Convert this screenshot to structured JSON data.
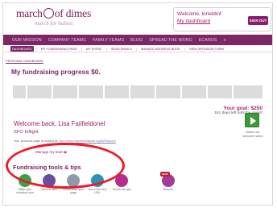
{
  "header": {
    "logo_main_left": "march",
    "logo_main_right": "of dimes",
    "logo_tagline": "march for babies",
    "welcome_text": "Welcome, lorieldinf",
    "dashboard_link": "My dashboard",
    "sign_out_label": "SIGN OUT"
  },
  "nav": {
    "items": [
      {
        "label": "OUR MISSION"
      },
      {
        "label": "COMPANY TEAMS"
      },
      {
        "label": "FAMILY TEAMS"
      },
      {
        "label": "BLOG"
      },
      {
        "label": "SPREAD THE WORD"
      },
      {
        "label": "ECARDS"
      }
    ],
    "more": "≡"
  },
  "subnav": {
    "items": [
      {
        "label": "DASHBOARD",
        "active": true
      },
      {
        "label": "MY FUNDRAISING PAGE"
      },
      {
        "label": "MY EVENT"
      },
      {
        "label": "SEND EMAILS"
      },
      {
        "label": "MANAGE ADDRESS BOOK"
      },
      {
        "label": "VIEW SPONSOR FORM"
      }
    ]
  },
  "breadcrumb": "PERSONAL DASHBOARD",
  "progress": {
    "title": "My fundraising progress $0.",
    "goal": "Your goal: $250",
    "days_left": "161 days left until the event!",
    "fraction_raised": 0
  },
  "welcome": {
    "greeting": "Welcome back, Lisa Faiifieldonel",
    "team": "SFO Inflight",
    "url_prefix": "Your personal page is located at:",
    "url": "http://www.marchforbabies.org/lisFieldone"
  },
  "video": {
    "label": "Watch our welcome video"
  },
  "manage_link": "Manage my team ▶",
  "tools": {
    "title": "Fundraising tools & tips",
    "new_badge": "NEW!",
    "items": [
      {
        "label": "Make your donation now",
        "color": "#3aa14a",
        "icon": "donate-icon"
      },
      {
        "label": "Send emails",
        "color": "#6a4e9e",
        "icon": "email-icon"
      },
      {
        "label": "Personalize your page",
        "color": "#8e9aa8",
        "icon": "personalize-icon"
      },
      {
        "label": "Get a free tiny URL",
        "color": "#2e92b8",
        "icon": "url-icon"
      },
      {
        "label": "Check the tips",
        "color": "#b62d8c",
        "icon": "tips-icon"
      },
      {
        "label": "Buttons",
        "color": "#a13a9a",
        "icon": "badge-icon"
      }
    ]
  },
  "colors": {
    "brand_purple": "#7d2766",
    "accent_magenta": "#a02070",
    "annotation_red": "#e81c2c",
    "video_green": "#3a9a3a"
  }
}
